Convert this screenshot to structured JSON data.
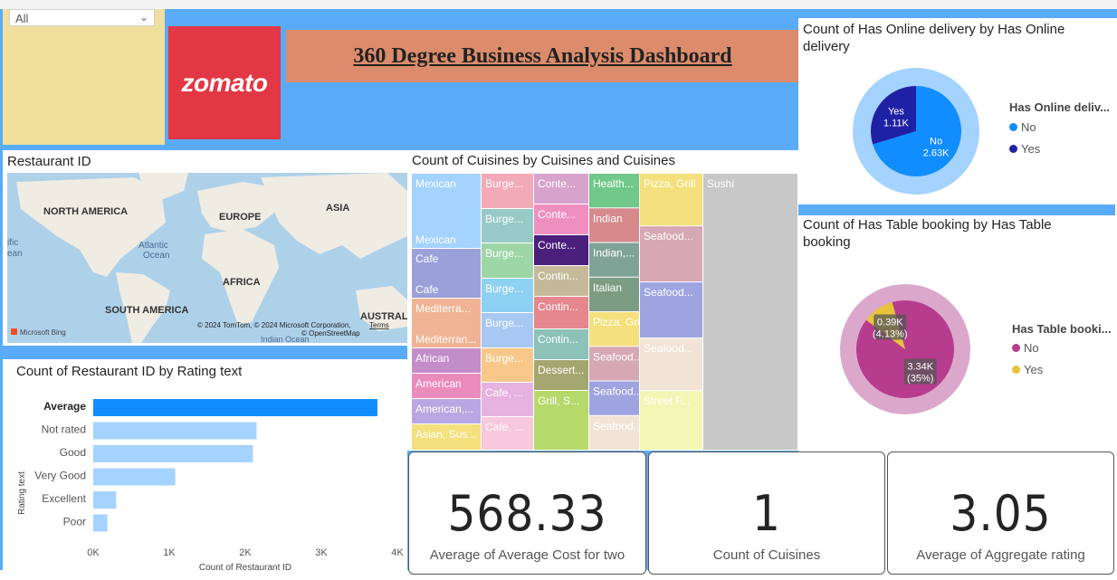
{
  "slicer": {
    "value": "All"
  },
  "logo": {
    "text": "zomato"
  },
  "header": {
    "title": "360 Degree Business Analysis Dashboard"
  },
  "map": {
    "title": "Restaurant ID",
    "labels": {
      "na": "NORTH AMERICA",
      "eu": "EUROPE",
      "as": "ASIA",
      "af": "AFRICA",
      "sa": "SOUTH AMERICA",
      "au": "AUSTRALIA",
      "atl": "Atlantic",
      "atl2": "Ocean",
      "ind": "Indian Ocean",
      "pac1": "ific",
      "pac2": "ean"
    },
    "bing": "Microsoft Bing",
    "attr": "© 2024 TomTom, © 2024 Microsoft Corporation,",
    "terms": "Terms",
    "osm": "© OpenStreetMap"
  },
  "colors": {
    "accent": "#118dff",
    "bar_light": "#a5d3ff",
    "donut_dark": "#1f21a5",
    "table_no": "#b73c8d",
    "table_yes": "#e7c43a",
    "band": "#5aabf7"
  },
  "chart_data": [
    {
      "type": "bar",
      "orientation": "horizontal",
      "title": "Count of Restaurant ID by Rating text",
      "xlabel": "Count of Restaurant ID",
      "ylabel": "Rating text",
      "categories": [
        "Average",
        "Not rated",
        "Good",
        "Very Good",
        "Excellent",
        "Poor"
      ],
      "values": [
        3737,
        2148,
        2100,
        1079,
        301,
        186
      ],
      "xlim": [
        0,
        4000
      ],
      "xticks": [
        "0K",
        "1K",
        "2K",
        "3K",
        "4K"
      ],
      "highlight": "Average"
    },
    {
      "type": "treemap",
      "title": "Count of Cuisines by Cuisines and Cuisines",
      "cells": [
        {
          "t": "Mexican",
          "t2": "Mexican",
          "c": "#a5d3ff"
        },
        {
          "t": "Cafe",
          "t2": "Cafe",
          "c": "#9aa1d9"
        },
        {
          "t": "Mediterra...",
          "t2": "Mediterran...",
          "c": "#f0b494"
        },
        {
          "t": "African",
          "c": "#c38dc9"
        },
        {
          "t": "American",
          "c": "#eb8bbd"
        },
        {
          "t": "American,...",
          "c": "#b8a7e3"
        },
        {
          "t": "Asian, Sus...",
          "c": "#f4e07c"
        },
        {
          "t": "Burge...",
          "c": "#f2a9b8"
        },
        {
          "t": "Burge...",
          "c": "#97c9c6"
        },
        {
          "t": "Burge...",
          "c": "#9ed6a7"
        },
        {
          "t": "Burge...",
          "c": "#8fd1f3"
        },
        {
          "t": "Burge...",
          "c": "#a7c8f2"
        },
        {
          "t": "Burge...",
          "c": "#f7c889"
        },
        {
          "t": "Cafe, ...",
          "c": "#e6b2df"
        },
        {
          "t": "Cafe, ...",
          "c": "#f8c8dc"
        },
        {
          "t": "Conte...",
          "c": "#d7a2cc"
        },
        {
          "t": "Conte...",
          "c": "#ef8fc0"
        },
        {
          "t": "Conte...",
          "c": "#4b1f7c"
        },
        {
          "t": "Contin...",
          "c": "#c4ba9a"
        },
        {
          "t": "Contin...",
          "c": "#e5878d"
        },
        {
          "t": "Contin...",
          "c": "#8cc2b7"
        },
        {
          "t": "Dessert...",
          "c": "#a3a76f"
        },
        {
          "t": "Grill, S...",
          "c": "#b6d96b"
        },
        {
          "t": "Health...",
          "c": "#70c88a"
        },
        {
          "t": "Indian",
          "c": "#d68a8c"
        },
        {
          "t": "Indian,...",
          "c": "#7fa397"
        },
        {
          "t": "Italian",
          "c": "#7c9c84"
        },
        {
          "t": "Pizza, Grill",
          "c": "#f4e07c"
        },
        {
          "t": "Seafood...",
          "c": "#d6a7b5"
        },
        {
          "t": "Seafood...",
          "c": "#9ea4e0"
        },
        {
          "t": "Seafood...",
          "c": "#f1e3d5"
        },
        {
          "t": "Street F...",
          "c": "#f2f7b5"
        },
        {
          "t": "Sushi",
          "c": "#c8c8c8"
        }
      ]
    },
    {
      "type": "pie",
      "subtype": "donut",
      "title": "Count of Has Online delivery by Has Online delivery",
      "legend_title": "Has Online deliv...",
      "legend_position": "right",
      "slices": [
        {
          "name": "No",
          "value": 2630,
          "label": "2.63K",
          "color": "#118dff"
        },
        {
          "name": "Yes",
          "value": 1110,
          "label": "1.11K",
          "color": "#1f21a5"
        }
      ]
    },
    {
      "type": "pie",
      "subtype": "donut",
      "title": "Count of Has Table booking by Has Table booking",
      "legend_title": "Has Table booki...",
      "legend_position": "right",
      "slices": [
        {
          "name": "No",
          "value": 3340,
          "label": "3.34K",
          "pct": "(35%)",
          "color": "#b73c8d"
        },
        {
          "name": "Yes",
          "value": 390,
          "label": "0.39K",
          "pct": "(4.13%)",
          "color": "#e7c43a"
        }
      ]
    }
  ],
  "cards": [
    {
      "value": "568.33",
      "label": "Average of Average Cost for two"
    },
    {
      "value": "1",
      "label": "Count of Cuisines"
    },
    {
      "value": "3.05",
      "label": "Average of Aggregate rating"
    }
  ]
}
